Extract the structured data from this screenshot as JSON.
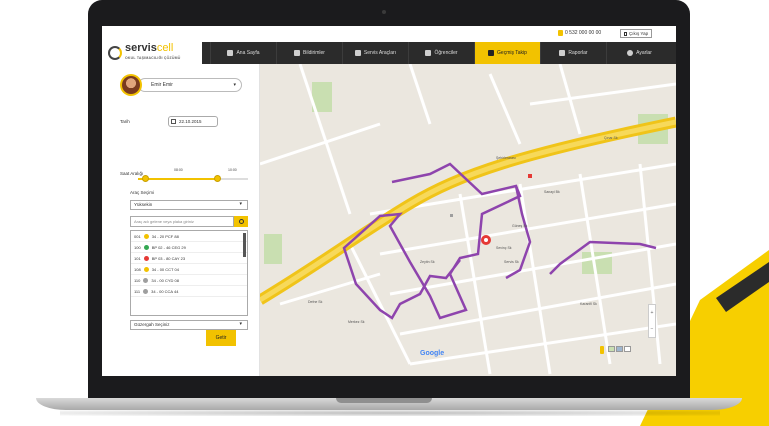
{
  "header": {
    "phone": "0 532 000 00 00",
    "logout_label": "Çıkış Yap",
    "logo": {
      "brand_main": "servis",
      "brand_accent": "cell",
      "tagline": "OKUL TAŞIMACILIĞI ÇÖZÜMÜ"
    },
    "nav": [
      {
        "label": "Ana Sayfa",
        "icon": "home-icon",
        "active": false
      },
      {
        "label": "Bildirimler",
        "icon": "megaphone-icon",
        "active": false
      },
      {
        "label": "Servis Araçları",
        "icon": "monitor-icon",
        "active": false
      },
      {
        "label": "Öğrenciler",
        "icon": "users-icon",
        "active": false
      },
      {
        "label": "Geçmiş Takip",
        "icon": "list-icon",
        "active": true
      },
      {
        "label": "Raporlar",
        "icon": "bar-chart-icon",
        "active": false
      },
      {
        "label": "Ayarlar",
        "icon": "gear-icon",
        "active": false
      }
    ]
  },
  "sidebar": {
    "user_name": "Emir Emir",
    "date_label": "Tarih",
    "date_value": "22.10.2015",
    "time_label": "Saat Aralığı",
    "time_start": "08:00",
    "time_end": "10:00",
    "vehicle_label": "Araç Seçimi",
    "vehicle_select": "Yüksekin",
    "search_placeholder": "Araç adı gelene veya plaka giriniz",
    "vehicles": [
      {
        "code": "001",
        "plate": "34 - 20 PCF 88",
        "color": "#f2c200"
      },
      {
        "code": "100",
        "plate": "BP 02 - 46 CEG 29",
        "color": "#34a853"
      },
      {
        "code": "101",
        "plate": "BP 03 - 80 CAY 23",
        "color": "#e53935"
      },
      {
        "code": "108",
        "plate": "34 - 00 CCT 04",
        "color": "#f2c200"
      },
      {
        "code": "110",
        "plate": "34 - 00 CYD 08",
        "color": "#9e9e9e"
      },
      {
        "code": "111",
        "plate": "34 - 00 CCA 44",
        "color": "#9e9e9e"
      }
    ],
    "route_select": "Güzergah Seçiniz",
    "show_button": "Getir"
  },
  "map": {
    "logo": "Google",
    "streets": [
      "Şehirlerarası",
      "Sanayi Bk",
      "Güneş Sk",
      "Zeytin Sk",
      "Sevinç Sk",
      "Karanfil Sk",
      "Servis Sk",
      "Merkez Sk",
      "Defne Sk",
      "Çınar Sk"
    ],
    "zoom_in": "+",
    "zoom_out": "−"
  }
}
